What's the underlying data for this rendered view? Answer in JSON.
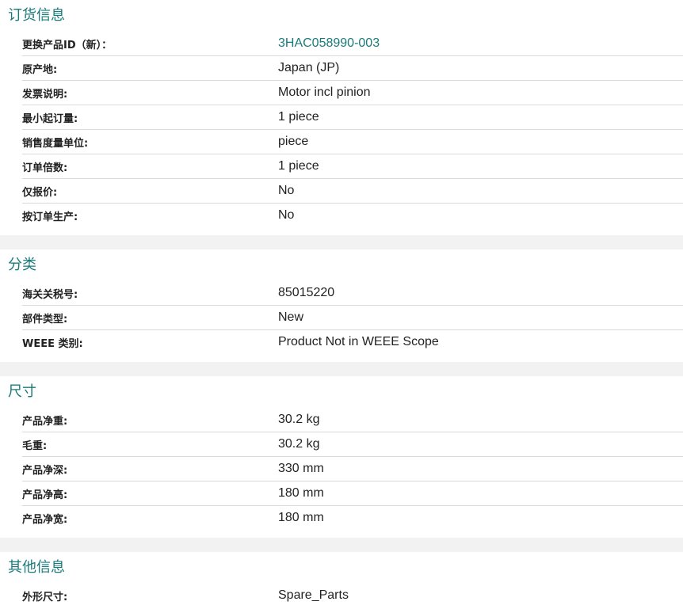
{
  "ordering": {
    "title": "订货信息",
    "rows": [
      {
        "label": "更换产品ID（新）：",
        "value": "3HAC058990-003"
      },
      {
        "label": "原产地:",
        "value": "Japan (JP)"
      },
      {
        "label": "发票说明:",
        "value": "Motor incl pinion"
      },
      {
        "label": "最小起订量:",
        "value": "1 piece"
      },
      {
        "label": "销售度量单位:",
        "value": "piece"
      },
      {
        "label": "订单倍数:",
        "value": "1 piece"
      },
      {
        "label": "仅报价:",
        "value": "No"
      },
      {
        "label": "按订单生产:",
        "value": "No"
      }
    ]
  },
  "classification": {
    "title": "分类",
    "rows": [
      {
        "label": "海关关税号:",
        "value": "85015220"
      },
      {
        "label": "部件类型:",
        "value": "New"
      },
      {
        "label": "WEEE 类别:",
        "value": "Product Not in WEEE Scope"
      }
    ]
  },
  "dimensions": {
    "title": "尺寸",
    "rows": [
      {
        "label": "产品净重:",
        "value": "30.2 kg"
      },
      {
        "label": "毛重:",
        "value": "30.2 kg"
      },
      {
        "label": "产品净深:",
        "value": "330 mm"
      },
      {
        "label": "产品净高:",
        "value": "180 mm"
      },
      {
        "label": "产品净宽:",
        "value": "180 mm"
      }
    ]
  },
  "other": {
    "title": "其他信息",
    "rows": [
      {
        "label": "外形尺寸:",
        "value": "Spare_Parts"
      }
    ]
  },
  "colors": {
    "accent": "#1a7a7a",
    "divider": "#d9d9d9",
    "section_gap": "#f2f2f2"
  }
}
